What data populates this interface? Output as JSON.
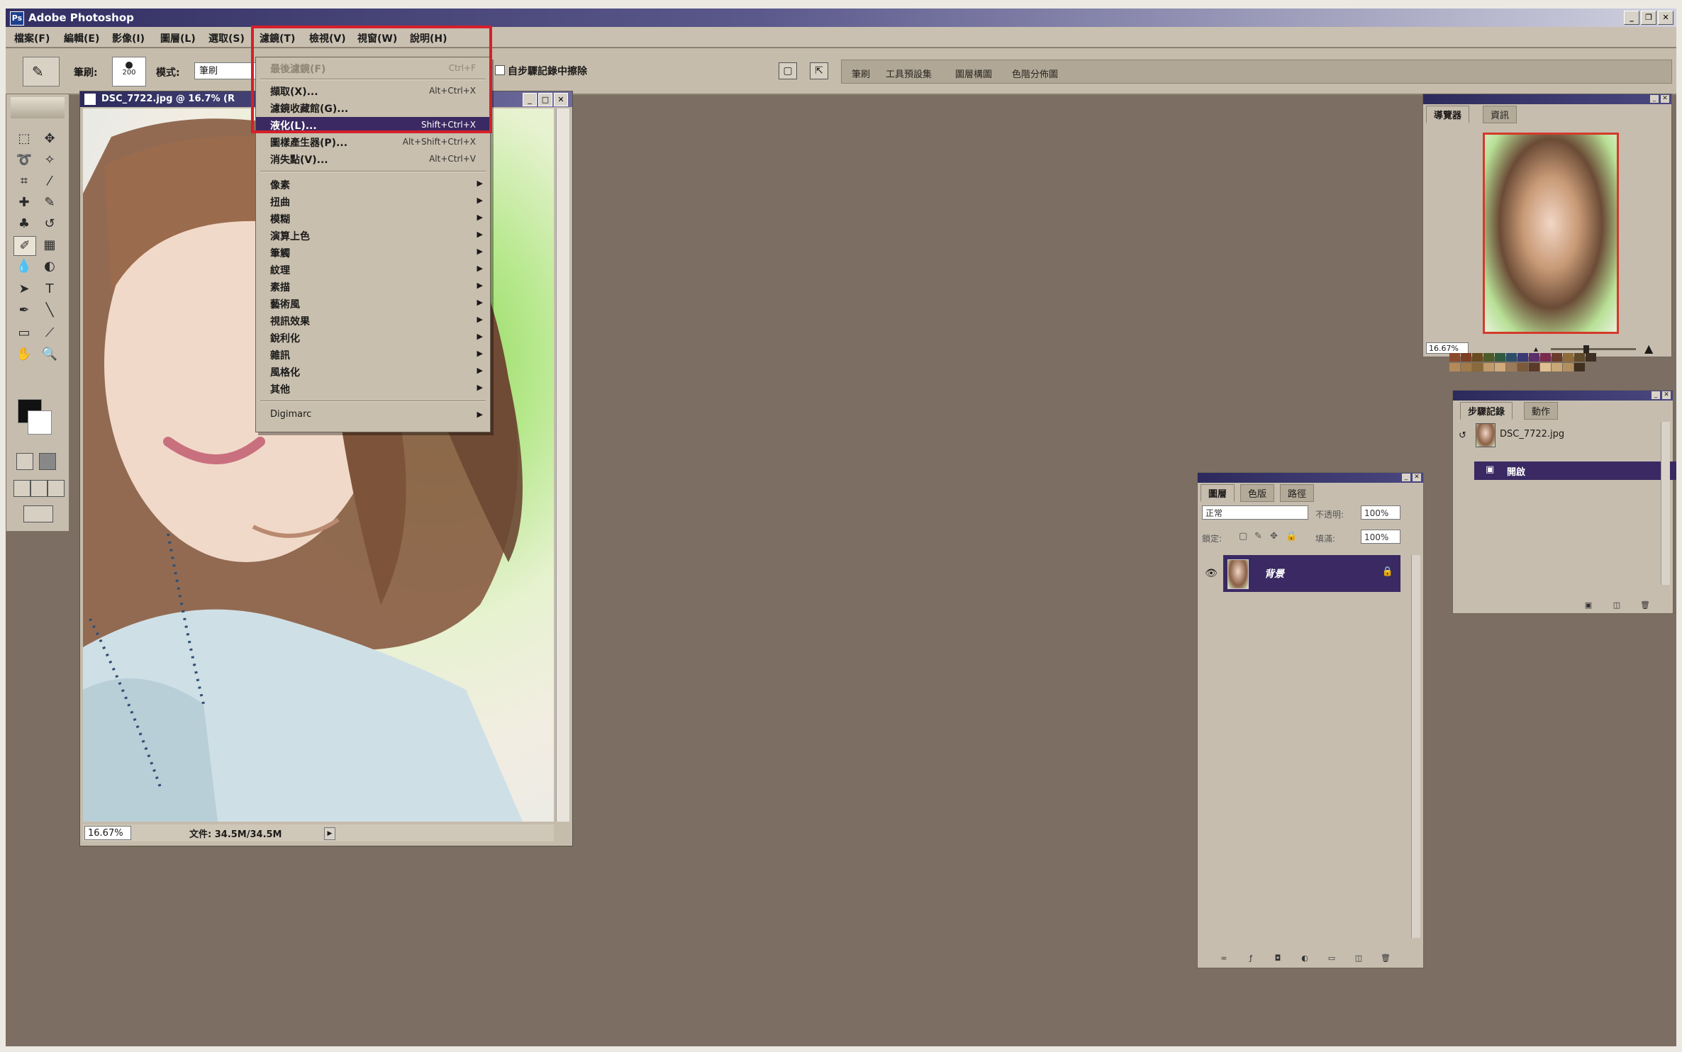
{
  "app": {
    "title": "Adobe Photoshop"
  },
  "menubar": [
    {
      "label": "檔案(F)"
    },
    {
      "label": "編輯(E)"
    },
    {
      "label": "影像(I)"
    },
    {
      "label": "圖層(L)"
    },
    {
      "label": "選取(S)"
    },
    {
      "label": "濾鏡(T)"
    },
    {
      "label": "檢視(V)"
    },
    {
      "label": "視窗(W)"
    },
    {
      "label": "說明(H)"
    }
  ],
  "options": {
    "brush_label": "筆刷:",
    "brush_size": "200",
    "mode_label": "模式:",
    "mode_value": "筆刷",
    "erase_history_label": "自步驟記錄中擦除",
    "palette_well": [
      "筆刷",
      "工具預設集",
      "圖層構圖",
      "色階分佈圖"
    ]
  },
  "document": {
    "title": "DSC_7722.jpg @ 16.7% (R",
    "zoom": "16.67%",
    "file_size": "文件: 34.5M/34.5M"
  },
  "filter_menu": {
    "items": [
      {
        "label": "最後濾鏡(F)",
        "shortcut": "Ctrl+F",
        "disabled": true
      },
      {
        "label": "擷取(X)...",
        "shortcut": "Alt+Ctrl+X"
      },
      {
        "label": "濾鏡收藏館(G)...",
        "shortcut": ""
      },
      {
        "label": "液化(L)...",
        "shortcut": "Shift+Ctrl+X",
        "highlighted": true
      },
      {
        "label": "圖樣產生器(P)...",
        "shortcut": "Alt+Shift+Ctrl+X"
      },
      {
        "label": "消失點(V)...",
        "shortcut": "Alt+Ctrl+V"
      },
      {
        "label": "像素",
        "submenu": true
      },
      {
        "label": "扭曲",
        "submenu": true
      },
      {
        "label": "模糊",
        "submenu": true
      },
      {
        "label": "演算上色",
        "submenu": true
      },
      {
        "label": "筆觸",
        "submenu": true
      },
      {
        "label": "紋理",
        "submenu": true
      },
      {
        "label": "素描",
        "submenu": true
      },
      {
        "label": "藝術風",
        "submenu": true
      },
      {
        "label": "視訊效果",
        "submenu": true
      },
      {
        "label": "銳利化",
        "submenu": true
      },
      {
        "label": "雜訊",
        "submenu": true
      },
      {
        "label": "風格化",
        "submenu": true
      },
      {
        "label": "其他",
        "submenu": true
      },
      {
        "label": "Digimarc",
        "submenu": true
      }
    ]
  },
  "navigator": {
    "tabs": [
      "導覽器",
      "資訊"
    ],
    "zoom": "16.67%"
  },
  "history": {
    "tabs": [
      "步驟記錄",
      "動作"
    ],
    "snapshot": "DSC_7722.jpg",
    "step": "開啟"
  },
  "layers": {
    "tabs": [
      "圖層",
      "色版",
      "路徑"
    ],
    "blend_mode": "正常",
    "opacity_label": "不透明:",
    "opacity_value": "100%",
    "lock_label": "鎖定:",
    "fill_label": "填滿:",
    "fill_value": "100%",
    "layer_name": "背景"
  },
  "colors": {
    "selection": "#3a2962",
    "workspace": "#7c6e62",
    "highlight_box": "#d4202a"
  }
}
